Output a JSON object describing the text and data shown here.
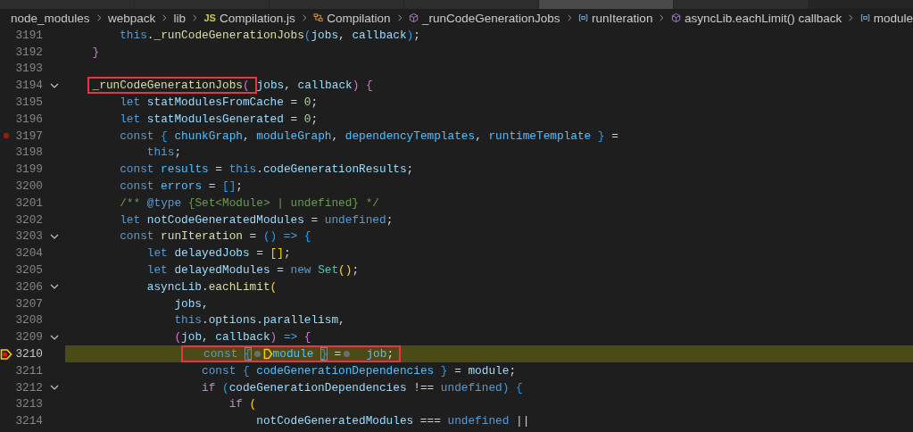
{
  "tabs": [
    {
      "selected": false
    },
    {
      "selected": false
    },
    {
      "selected": false
    },
    {
      "selected": false
    },
    {
      "selected": true
    },
    {
      "selected": false
    }
  ],
  "breadcrumb": [
    {
      "text": "node_modules",
      "kind": "folder"
    },
    {
      "text": "webpack",
      "kind": "folder"
    },
    {
      "text": "lib",
      "kind": "folder"
    },
    {
      "text": "Compilation.js",
      "kind": "file",
      "badge": "JS"
    },
    {
      "text": "Compilation",
      "kind": "class"
    },
    {
      "text": "_runCodeGenerationJobs",
      "kind": "method"
    },
    {
      "text": "runIteration",
      "kind": "variable"
    },
    {
      "text": "asyncLib.eachLimit() callback",
      "kind": "method"
    },
    {
      "text": "module",
      "kind": "variable"
    }
  ],
  "lines": [
    {
      "number": "3191",
      "fold": false,
      "breakpoint": false,
      "current": false,
      "tokens": [
        {
          "text": "        this",
          "kind": "keyword"
        },
        {
          "text": ".",
          "kind": "plain"
        },
        {
          "text": "_runCodeGenerationJobs",
          "kind": "function"
        },
        {
          "text": "(",
          "kind": "bracket3"
        },
        {
          "text": "jobs",
          "kind": "variable"
        },
        {
          "text": ", ",
          "kind": "plain"
        },
        {
          "text": "callback",
          "kind": "variable"
        },
        {
          "text": ")",
          "kind": "bracket3"
        },
        {
          "text": ";",
          "kind": "plain"
        }
      ]
    },
    {
      "number": "3192",
      "fold": false,
      "breakpoint": false,
      "current": false,
      "tokens": [
        {
          "text": "    }",
          "kind": "bracket2"
        }
      ]
    },
    {
      "number": "3193",
      "fold": false,
      "breakpoint": false,
      "current": false
    },
    {
      "number": "3194",
      "fold": true,
      "breakpoint": false,
      "current": false,
      "tokens": [
        {
          "kind": "box",
          "tokens": [
            {
              "text": "    _runCodeGenerationJobs",
              "kind": "function"
            },
            {
              "text": "(",
              "kind": "bracket2"
            }
          ]
        },
        {
          "text": "jobs",
          "kind": "variable"
        },
        {
          "text": ", ",
          "kind": "plain"
        },
        {
          "text": "callback",
          "kind": "variable"
        },
        {
          "text": ")",
          "kind": "bracket2"
        },
        {
          "text": " {",
          "kind": "bracket2"
        }
      ]
    },
    {
      "number": "3195",
      "fold": false,
      "breakpoint": false,
      "current": false,
      "tokens": [
        {
          "text": "        let",
          "kind": "keyword"
        },
        {
          "text": " statModulesFromCache",
          "kind": "variable"
        },
        {
          "text": " = ",
          "kind": "plain"
        },
        {
          "text": "0",
          "kind": "number"
        },
        {
          "text": ";",
          "kind": "plain"
        }
      ]
    },
    {
      "number": "3196",
      "fold": false,
      "breakpoint": false,
      "current": false,
      "tokens": [
        {
          "text": "        let",
          "kind": "keyword"
        },
        {
          "text": " statModulesGenerated",
          "kind": "variable"
        },
        {
          "text": " = ",
          "kind": "plain"
        },
        {
          "text": "0",
          "kind": "number"
        },
        {
          "text": ";",
          "kind": "plain"
        }
      ]
    },
    {
      "number": "3197",
      "fold": false,
      "breakpoint": true,
      "current": false,
      "tokens": [
        {
          "text": "        const",
          "kind": "keyword"
        },
        {
          "text": " { ",
          "kind": "bracket3"
        },
        {
          "text": "chunkGraph",
          "kind": "constant"
        },
        {
          "text": ", ",
          "kind": "plain"
        },
        {
          "text": "moduleGraph",
          "kind": "constant"
        },
        {
          "text": ", ",
          "kind": "plain"
        },
        {
          "text": "dependencyTemplates",
          "kind": "constant"
        },
        {
          "text": ", ",
          "kind": "plain"
        },
        {
          "text": "runtimeTemplate",
          "kind": "constant"
        },
        {
          "text": " }",
          "kind": "bracket3"
        },
        {
          "text": " =",
          "kind": "plain"
        }
      ]
    },
    {
      "number": "3198",
      "fold": false,
      "breakpoint": false,
      "current": false,
      "tokens": [
        {
          "text": "            this",
          "kind": "keyword"
        },
        {
          "text": ";",
          "kind": "plain"
        }
      ]
    },
    {
      "number": "3199",
      "fold": false,
      "breakpoint": false,
      "current": false,
      "tokens": [
        {
          "text": "        const",
          "kind": "keyword"
        },
        {
          "text": " results",
          "kind": "constant"
        },
        {
          "text": " = ",
          "kind": "plain"
        },
        {
          "text": "this",
          "kind": "keyword"
        },
        {
          "text": ".",
          "kind": "plain"
        },
        {
          "text": "codeGenerationResults",
          "kind": "variable"
        },
        {
          "text": ";",
          "kind": "plain"
        }
      ]
    },
    {
      "number": "3200",
      "fold": false,
      "breakpoint": false,
      "current": false,
      "tokens": [
        {
          "text": "        const",
          "kind": "keyword"
        },
        {
          "text": " errors",
          "kind": "constant"
        },
        {
          "text": " = ",
          "kind": "plain"
        },
        {
          "text": "[]",
          "kind": "bracket3"
        },
        {
          "text": ";",
          "kind": "plain"
        }
      ]
    },
    {
      "number": "3201",
      "fold": false,
      "breakpoint": false,
      "current": false,
      "tokens": [
        {
          "text": "        /** ",
          "kind": "comment"
        },
        {
          "text": "@type",
          "kind": "keyword"
        },
        {
          "text": " {Set<Module> | undefined} */",
          "kind": "comment"
        }
      ]
    },
    {
      "number": "3202",
      "fold": false,
      "breakpoint": false,
      "current": false,
      "tokens": [
        {
          "text": "        let",
          "kind": "keyword"
        },
        {
          "text": " notCodeGeneratedModules",
          "kind": "variable"
        },
        {
          "text": " = ",
          "kind": "plain"
        },
        {
          "text": "undefined",
          "kind": "keyword"
        },
        {
          "text": ";",
          "kind": "plain"
        }
      ]
    },
    {
      "number": "3203",
      "fold": true,
      "breakpoint": false,
      "current": false,
      "tokens": [
        {
          "text": "        const",
          "kind": "keyword"
        },
        {
          "text": " runIteration",
          "kind": "function"
        },
        {
          "text": " = ",
          "kind": "plain"
        },
        {
          "text": "()",
          "kind": "bracket3"
        },
        {
          "text": " => ",
          "kind": "keyword"
        },
        {
          "text": "{",
          "kind": "bracket3"
        }
      ]
    },
    {
      "number": "3204",
      "fold": false,
      "breakpoint": false,
      "current": false,
      "tokens": [
        {
          "text": "            let",
          "kind": "keyword"
        },
        {
          "text": " delayedJobs",
          "kind": "variable"
        },
        {
          "text": " = ",
          "kind": "plain"
        },
        {
          "text": "[]",
          "kind": "bracket1"
        },
        {
          "text": ";",
          "kind": "plain"
        }
      ]
    },
    {
      "number": "3205",
      "fold": false,
      "breakpoint": false,
      "current": false,
      "tokens": [
        {
          "text": "            let",
          "kind": "keyword"
        },
        {
          "text": " delayedModules",
          "kind": "variable"
        },
        {
          "text": " = ",
          "kind": "plain"
        },
        {
          "text": "new",
          "kind": "keyword"
        },
        {
          "text": " Set",
          "kind": "class"
        },
        {
          "text": "()",
          "kind": "bracket1"
        },
        {
          "text": ";",
          "kind": "plain"
        }
      ]
    },
    {
      "number": "3206",
      "fold": true,
      "breakpoint": false,
      "current": false,
      "tokens": [
        {
          "text": "            asyncLib",
          "kind": "variable"
        },
        {
          "text": ".",
          "kind": "plain"
        },
        {
          "text": "eachLimit",
          "kind": "function"
        },
        {
          "text": "(",
          "kind": "bracket1"
        }
      ]
    },
    {
      "number": "3207",
      "fold": false,
      "breakpoint": false,
      "current": false,
      "tokens": [
        {
          "text": "                jobs",
          "kind": "variable"
        },
        {
          "text": ",",
          "kind": "plain"
        }
      ]
    },
    {
      "number": "3208",
      "fold": false,
      "breakpoint": false,
      "current": false,
      "tokens": [
        {
          "text": "                this",
          "kind": "keyword"
        },
        {
          "text": ".",
          "kind": "plain"
        },
        {
          "text": "options",
          "kind": "variable"
        },
        {
          "text": ".",
          "kind": "plain"
        },
        {
          "text": "parallelism",
          "kind": "variable"
        },
        {
          "text": ",",
          "kind": "plain"
        }
      ]
    },
    {
      "number": "3209",
      "fold": true,
      "breakpoint": false,
      "current": false,
      "tokens": [
        {
          "text": "                (",
          "kind": "bracket2"
        },
        {
          "text": "job",
          "kind": "variable"
        },
        {
          "text": ", ",
          "kind": "plain"
        },
        {
          "text": "callback",
          "kind": "variable"
        },
        {
          "text": ")",
          "kind": "bracket2"
        },
        {
          "text": " => ",
          "kind": "keyword"
        },
        {
          "text": "{",
          "kind": "bracket2"
        }
      ]
    },
    {
      "number": "3210",
      "fold": false,
      "breakpoint": true,
      "current": true,
      "tokens": [
        {
          "kind": "box",
          "tokens": [
            {
              "text": "                    const ",
              "kind": "keyword"
            },
            {
              "text": "{",
              "kind": "bracket3",
              "matched": true
            },
            {
              "kind": "dot"
            },
            {
              "kind": "arrow"
            },
            {
              "text": "module ",
              "kind": "constant"
            },
            {
              "text": "}",
              "kind": "bracket3",
              "matched": true
            },
            {
              "text": " =",
              "kind": "plain"
            },
            {
              "kind": "dot"
            },
            {
              "text": "  job",
              "kind": "constant"
            },
            {
              "text": ";",
              "kind": "plain"
            }
          ]
        }
      ]
    },
    {
      "number": "3211",
      "fold": false,
      "breakpoint": false,
      "current": false,
      "tokens": [
        {
          "text": "                    const",
          "kind": "keyword"
        },
        {
          "text": " { ",
          "kind": "bracket3"
        },
        {
          "text": "codeGenerationDependencies",
          "kind": "constant"
        },
        {
          "text": " }",
          "kind": "bracket3"
        },
        {
          "text": " = ",
          "kind": "plain"
        },
        {
          "text": "module",
          "kind": "variable"
        },
        {
          "text": ";",
          "kind": "plain"
        }
      ]
    },
    {
      "number": "3212",
      "fold": true,
      "breakpoint": false,
      "current": false,
      "tokens": [
        {
          "text": "                    if",
          "kind": "control"
        },
        {
          "text": " (",
          "kind": "bracket3"
        },
        {
          "text": "codeGenerationDependencies",
          "kind": "variable"
        },
        {
          "text": " !== ",
          "kind": "plain"
        },
        {
          "text": "undefined",
          "kind": "keyword"
        },
        {
          "text": ")",
          "kind": "bracket3"
        },
        {
          "text": " {",
          "kind": "bracket3"
        }
      ]
    },
    {
      "number": "3213",
      "fold": false,
      "breakpoint": false,
      "current": false,
      "tokens": [
        {
          "text": "                        if",
          "kind": "control"
        },
        {
          "text": " (",
          "kind": "bracket1"
        }
      ]
    },
    {
      "number": "3214",
      "fold": false,
      "breakpoint": false,
      "current": false,
      "tokens": [
        {
          "text": "                            notCodeGeneratedModules",
          "kind": "variable"
        },
        {
          "text": " === ",
          "kind": "plain"
        },
        {
          "text": "undefined",
          "kind": "keyword"
        },
        {
          "text": " ||",
          "kind": "plain"
        }
      ]
    }
  ]
}
